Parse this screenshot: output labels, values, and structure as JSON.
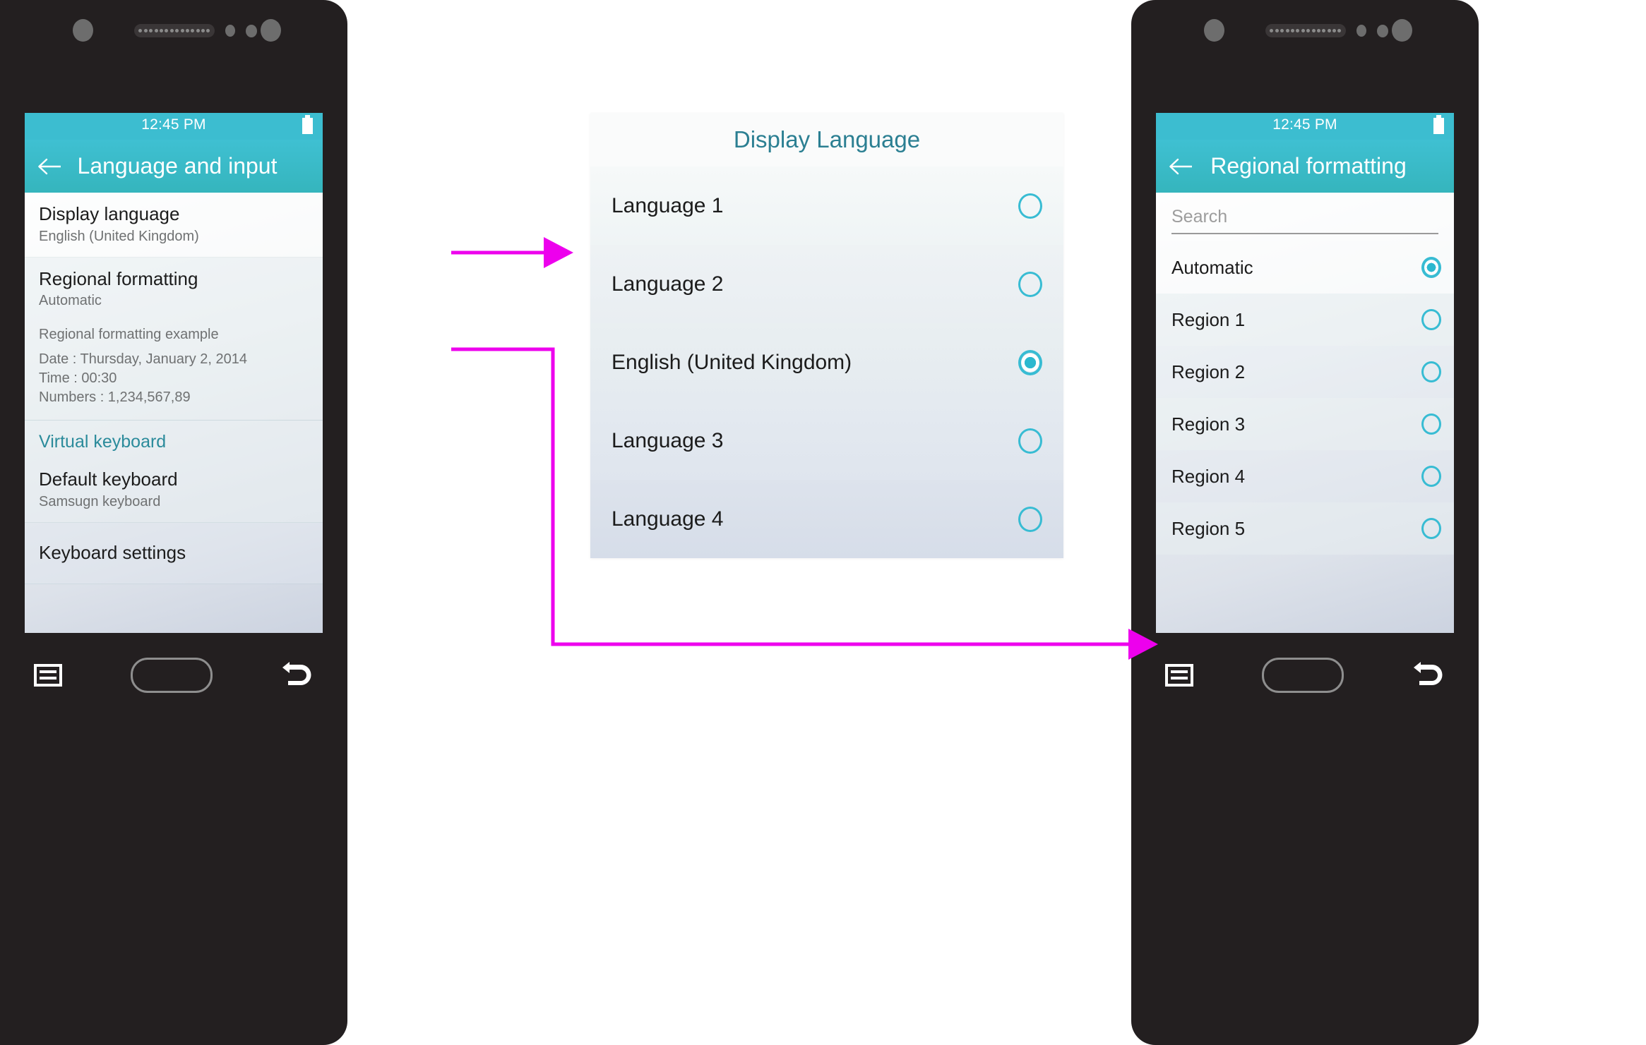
{
  "meta": {
    "accent_teal": "#3cbdd0",
    "accent_teal_dark": "#2b7f92",
    "connector_magenta": "#ed00ed",
    "phone_frame": "#231f20"
  },
  "phone_left": {
    "status": {
      "time": "12:45 PM",
      "battery_icon": "battery-icon"
    },
    "appbar": {
      "back_icon": "back-arrow-icon",
      "title": "Language and input"
    },
    "rows": [
      {
        "title": "Display language",
        "sub": "English (United Kingdom)"
      },
      {
        "title": "Regional formatting",
        "sub": "Automatic"
      }
    ],
    "example": {
      "heading": "Regional formatting example",
      "lines": [
        "Date : Thursday, January 2, 2014",
        "Time : 00:30",
        "Numbers : 1,234,567,89"
      ]
    },
    "section_header": "Virtual keyboard",
    "rows_2": [
      {
        "title": "Default keyboard",
        "sub": "Samsugn keyboard"
      },
      {
        "title": "Keyboard settings",
        "sub": ""
      }
    ],
    "nav": {
      "recents_icon": "recents-icon",
      "home_icon": "home-button",
      "back_icon": "back-icon"
    }
  },
  "dialog": {
    "title": "Display Language",
    "options": [
      {
        "label": "Language 1",
        "selected": false
      },
      {
        "label": "Language 2",
        "selected": false
      },
      {
        "label": "English (United Kingdom)",
        "selected": true
      },
      {
        "label": "Language 3",
        "selected": false
      },
      {
        "label": "Language 4",
        "selected": false
      }
    ]
  },
  "phone_right": {
    "status": {
      "time": "12:45 PM",
      "battery_icon": "battery-icon"
    },
    "appbar": {
      "back_icon": "back-arrow-icon",
      "title": "Regional formatting"
    },
    "search": {
      "value": "",
      "placeholder": "Search"
    },
    "options": [
      {
        "label": "Automatic",
        "selected": true
      },
      {
        "label": "Region 1",
        "selected": false
      },
      {
        "label": "Region 2",
        "selected": false
      },
      {
        "label": "Region 3",
        "selected": false
      },
      {
        "label": "Region 4",
        "selected": false
      },
      {
        "label": "Region 5",
        "selected": false
      }
    ],
    "nav": {
      "recents_icon": "recents-icon",
      "home_icon": "home-button",
      "back_icon": "back-icon"
    }
  }
}
